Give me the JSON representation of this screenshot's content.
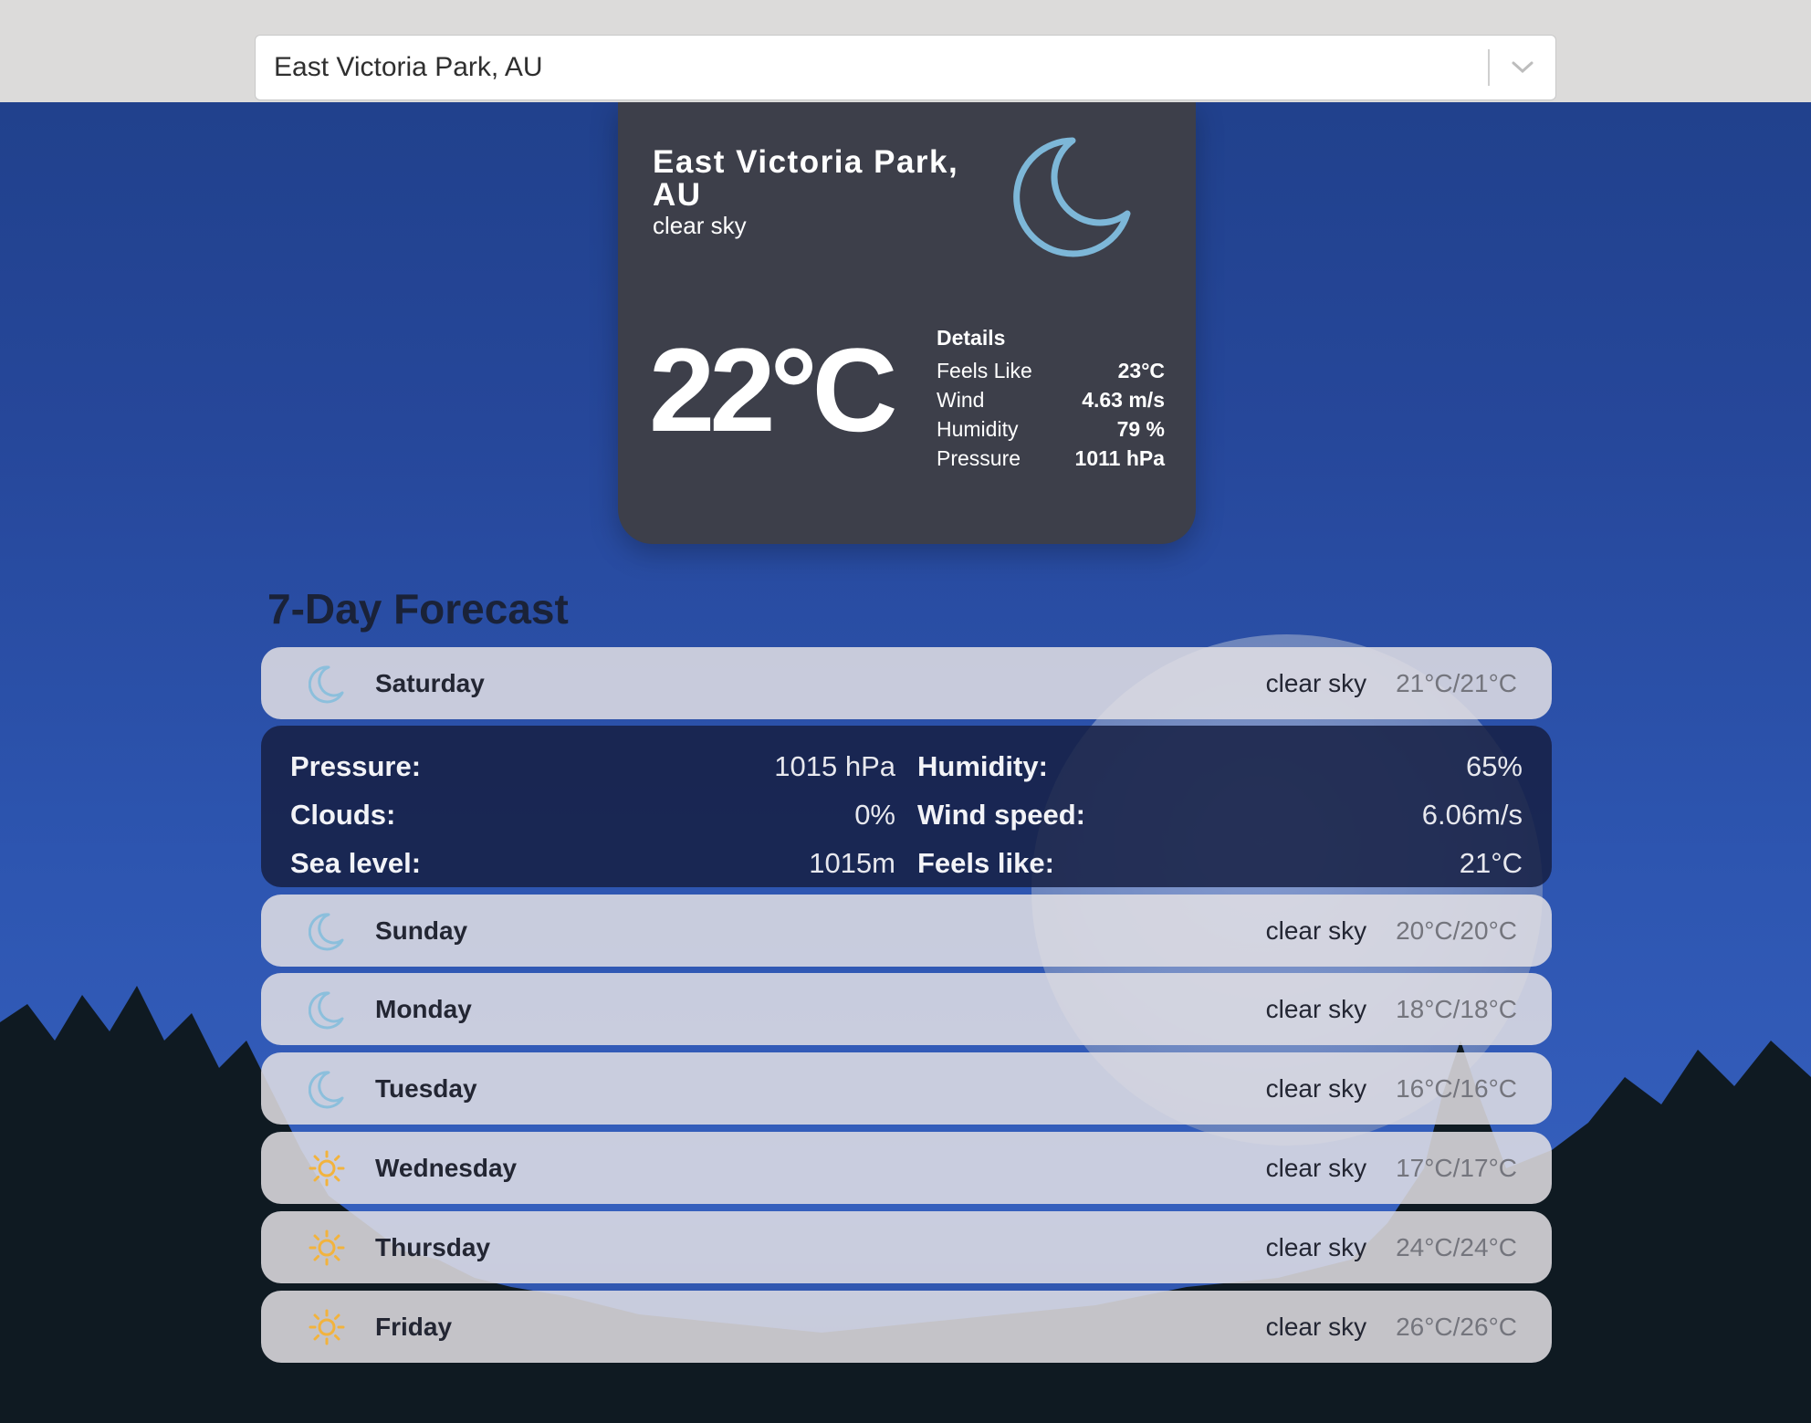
{
  "location_select": {
    "value": "East Victoria Park, AU"
  },
  "current": {
    "city": "East Victoria Park, AU",
    "description": "clear sky",
    "icon": "moon-icon",
    "temperature": "22°C",
    "details_title": "Details",
    "details": [
      {
        "label": "Feels Like",
        "value": "23°C"
      },
      {
        "label": "Wind",
        "value": "4.63 m/s"
      },
      {
        "label": "Humidity",
        "value": "79 %"
      },
      {
        "label": "Pressure",
        "value": "1011 hPa"
      }
    ]
  },
  "forecast": {
    "title": "7-Day Forecast",
    "days": [
      {
        "day": "Saturday",
        "icon": "moon-icon",
        "description": "clear sky",
        "temp": "21°C/21°C"
      },
      {
        "day": "Sunday",
        "icon": "moon-icon",
        "description": "clear sky",
        "temp": "20°C/20°C"
      },
      {
        "day": "Monday",
        "icon": "moon-icon",
        "description": "clear sky",
        "temp": "18°C/18°C"
      },
      {
        "day": "Tuesday",
        "icon": "moon-icon",
        "description": "clear sky",
        "temp": "16°C/16°C"
      },
      {
        "day": "Wednesday",
        "icon": "sun-icon",
        "description": "clear sky",
        "temp": "17°C/17°C"
      },
      {
        "day": "Thursday",
        "icon": "sun-icon",
        "description": "clear sky",
        "temp": "24°C/24°C"
      },
      {
        "day": "Friday",
        "icon": "sun-icon",
        "description": "clear sky",
        "temp": "26°C/26°C"
      }
    ],
    "expanded_details": [
      {
        "label": "Pressure:",
        "value": "1015 hPa"
      },
      {
        "label": "Humidity:",
        "value": "65%"
      },
      {
        "label": "Clouds:",
        "value": "0%"
      },
      {
        "label": "Wind speed:",
        "value": "6.06m/s"
      },
      {
        "label": "Sea level:",
        "value": "1015m"
      },
      {
        "label": "Feels like:",
        "value": "21°C"
      }
    ]
  },
  "colors": {
    "moon_icon": "#7db7d8",
    "sun_icon": "#f2b33d",
    "card_bg": "#3d3f4a",
    "panel_bg": "#162044"
  }
}
